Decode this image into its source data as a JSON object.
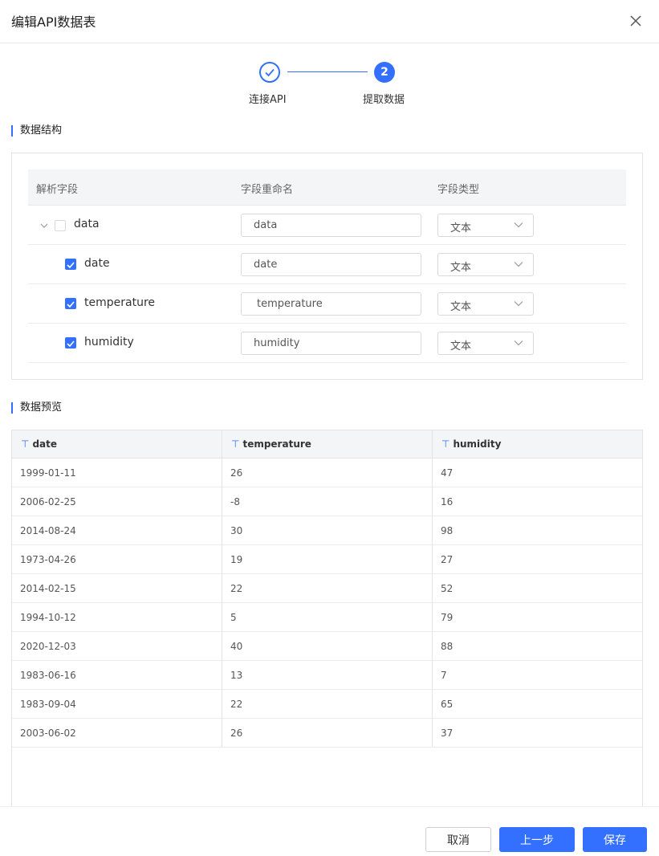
{
  "dialog": {
    "title": "编辑API数据表"
  },
  "steps": [
    {
      "label": "连接API",
      "state": "done"
    },
    {
      "number": "2",
      "label": "提取数据",
      "state": "active"
    }
  ],
  "structure": {
    "section_title": "数据结构",
    "headers": [
      "解析字段",
      "字段重命名",
      "字段类型"
    ],
    "rows": [
      {
        "field": "data",
        "rename": "data",
        "type": "文本",
        "checked": false,
        "expandable": true
      },
      {
        "field": "date",
        "rename": "date",
        "type": "文本",
        "checked": true
      },
      {
        "field": "temperature",
        "rename": "temperature",
        "type": "文本",
        "checked": true
      },
      {
        "field": "humidity",
        "rename": "humidity",
        "type": "文本",
        "checked": true
      }
    ]
  },
  "preview": {
    "section_title": "数据预览",
    "type_icon": "⊤",
    "columns": [
      "date",
      "temperature",
      "humidity"
    ],
    "rows": [
      [
        "1999-01-11",
        "26",
        "47"
      ],
      [
        "2006-02-25",
        "-8",
        "16"
      ],
      [
        "2014-08-24",
        "30",
        "98"
      ],
      [
        "1973-04-26",
        "19",
        "27"
      ],
      [
        "2014-02-15",
        "22",
        "52"
      ],
      [
        "1994-10-12",
        "5",
        "79"
      ],
      [
        "2020-12-03",
        "40",
        "88"
      ],
      [
        "1983-06-16",
        "13",
        "7"
      ],
      [
        "1983-09-04",
        "22",
        "65"
      ],
      [
        "2003-06-02",
        "26",
        "37"
      ]
    ]
  },
  "footer": {
    "cancel": "取消",
    "prev": "上一步",
    "save": "保存"
  },
  "colors": {
    "accent": "#3370ff"
  }
}
